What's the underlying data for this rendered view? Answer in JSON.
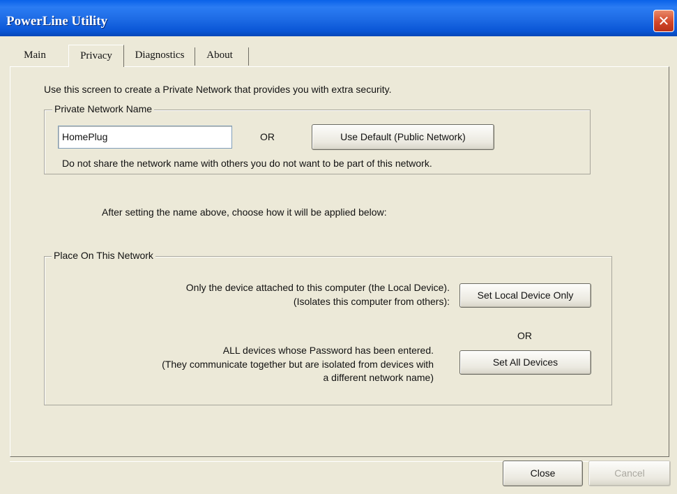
{
  "window": {
    "title": "PowerLine Utility",
    "close_glyph": "✕"
  },
  "tabs": [
    {
      "label": "Main"
    },
    {
      "label": "Privacy"
    },
    {
      "label": "Diagnostics"
    },
    {
      "label": "About"
    }
  ],
  "privacy": {
    "intro": "Use this screen to create a Private Network that provides you with extra security.",
    "name_group": {
      "title": "Private Network Name",
      "name_value": "HomePlug",
      "or_label": "OR",
      "default_button": "Use Default (Public Network)",
      "warning": "Do not share the network name with others you do not want to be part of this network."
    },
    "apply_note": "After setting the name above, choose how it will be applied below:",
    "place_group": {
      "title": "Place On This Network",
      "local_line1": "Only the device attached to this computer (the Local Device).",
      "local_line2": "(Isolates this computer from others):",
      "local_button": "Set Local Device Only",
      "or_label": "OR",
      "all_line1": "ALL devices whose Password has been entered.",
      "all_line2": "(They communicate together but are isolated from devices with",
      "all_line3": "a different network name)",
      "all_button": "Set All Devices"
    }
  },
  "footer": {
    "close_button": "Close",
    "cancel_button": "Cancel"
  }
}
